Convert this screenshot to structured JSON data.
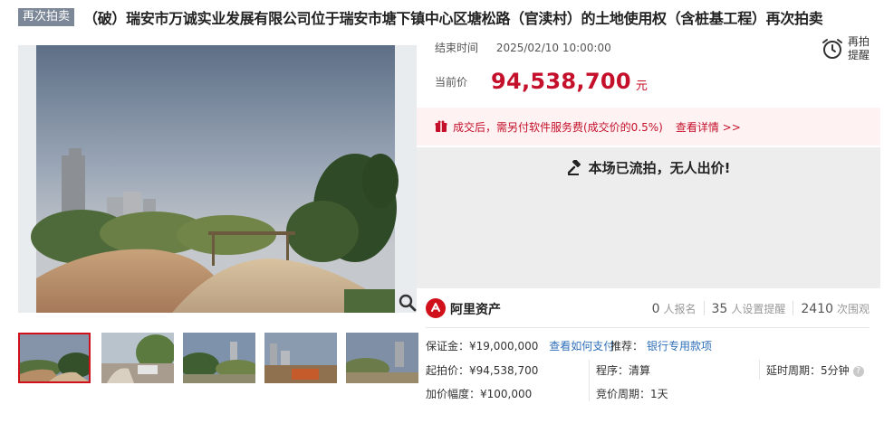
{
  "header": {
    "tag": "再次拍卖",
    "title": "（破）瑞安市万诚实业发展有限公司位于瑞安市塘下镇中心区塘松路（官渎村）的土地使用权（含桩基工程）再次拍卖"
  },
  "auction": {
    "end_label": "结束时间",
    "end_time": "2025/02/10 10:00:00",
    "remind_label_1": "再拍",
    "remind_label_2": "提醒",
    "price_label": "当前价",
    "price_value": "94,538,700",
    "price_unit": "元"
  },
  "fee": {
    "text": "成交后，需另付软件服务费(成交价的0.5%)",
    "link": "查看详情 >>"
  },
  "status": {
    "text": "本场已流拍，无人出价!"
  },
  "platform": {
    "name": "阿里资产"
  },
  "stats": [
    {
      "num": "0",
      "label": "人报名"
    },
    {
      "num": "35",
      "label": "人设置提醒"
    },
    {
      "num": "2410",
      "label": "次围观"
    }
  ],
  "details": {
    "deposit_label": "保证金：",
    "deposit_value": "¥19,000,000",
    "deposit_link": "查看如何支付",
    "recommend_label": "推荐：",
    "recommend_link": "银行专用款项",
    "start_label": "起拍价：",
    "start_value": "¥94,538,700",
    "procedure_label": "程序：",
    "procedure_value": "清算",
    "delay_label": "延时周期：",
    "delay_value": "5分钟",
    "increment_label": "加价幅度：",
    "increment_value": "¥100,000",
    "cycle_label": "竞价周期：",
    "cycle_value": "1天"
  },
  "colors": {
    "accent": "#c4102a",
    "link": "#2f6fb8",
    "tag_bg": "#7c8897",
    "fee_bg": "#fff2f3",
    "status_bg": "#ededed"
  },
  "icons": {
    "zoom": "search-icon",
    "remind": "alarm-clock-icon",
    "fee": "gift-icon",
    "status": "gavel-icon",
    "platform": "ali-logo-icon",
    "help": "help-icon"
  }
}
